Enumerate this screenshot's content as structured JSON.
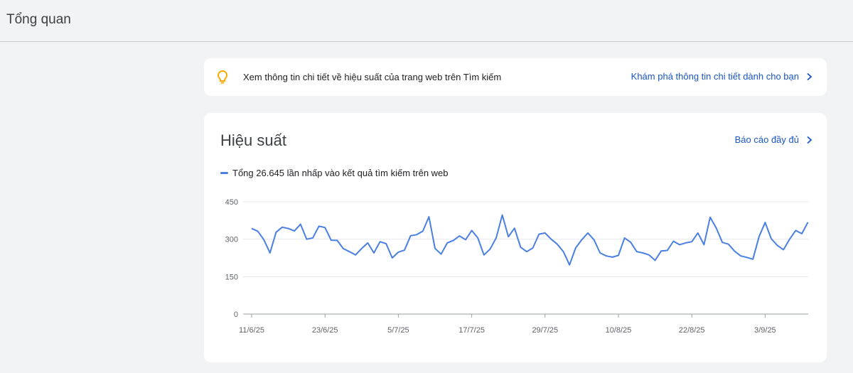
{
  "header": {
    "title": "Tổng quan"
  },
  "insight": {
    "text": "Xem thông tin chi tiết về hiệu suất của trang web trên Tìm kiếm",
    "link_label": "Khám phá thông tin chi tiết dành cho bạn",
    "icon": "lightbulb-icon",
    "icon_color": "#f9ab00"
  },
  "performance": {
    "title": "Hiệu suất",
    "full_report_label": "Báo cáo đầy đủ",
    "legend_label": "Tổng 26.645 lần nhấp vào kết quả tìm kiếm trên web"
  },
  "colors": {
    "accent": "#1a56c4",
    "series": "#4a7fe4",
    "background": "#f1f3f4"
  },
  "chart_data": {
    "type": "line",
    "x_ticks": [
      "11/6/25",
      "23/6/25",
      "5/7/25",
      "17/7/25",
      "29/7/25",
      "10/8/25",
      "22/8/25",
      "3/9/25"
    ],
    "y_ticks": [
      0,
      150,
      300,
      450
    ],
    "ylim": [
      0,
      450
    ],
    "grid": true,
    "series": [
      {
        "name": "Tổng 26.645 lần nhấp vào kết quả tìm kiếm trên web",
        "color": "#4a7fe4",
        "x": [
          "11/6/25",
          "12/6/25",
          "13/6/25",
          "14/6/25",
          "15/6/25",
          "16/6/25",
          "17/6/25",
          "18/6/25",
          "19/6/25",
          "20/6/25",
          "21/6/25",
          "22/6/25",
          "23/6/25",
          "24/6/25",
          "25/6/25",
          "26/6/25",
          "27/6/25",
          "28/6/25",
          "29/6/25",
          "30/6/25",
          "1/7/25",
          "2/7/25",
          "3/7/25",
          "4/7/25",
          "5/7/25",
          "6/7/25",
          "7/7/25",
          "8/7/25",
          "9/7/25",
          "10/7/25",
          "11/7/25",
          "12/7/25",
          "13/7/25",
          "14/7/25",
          "15/7/25",
          "16/7/25",
          "17/7/25",
          "18/7/25",
          "19/7/25",
          "20/7/25",
          "21/7/25",
          "22/7/25",
          "23/7/25",
          "24/7/25",
          "25/7/25",
          "26/7/25",
          "27/7/25",
          "28/7/25",
          "29/7/25",
          "30/7/25",
          "31/7/25",
          "1/8/25",
          "2/8/25",
          "3/8/25",
          "4/8/25",
          "5/8/25",
          "6/8/25",
          "7/8/25",
          "8/8/25",
          "9/8/25",
          "10/8/25",
          "11/8/25",
          "12/8/25",
          "13/8/25",
          "14/8/25",
          "15/8/25",
          "16/8/25",
          "17/8/25",
          "18/8/25",
          "19/8/25",
          "20/8/25",
          "21/8/25",
          "22/8/25",
          "23/8/25",
          "24/8/25",
          "25/8/25",
          "26/8/25",
          "27/8/25",
          "28/8/25",
          "29/8/25",
          "30/8/25",
          "31/8/25",
          "1/9/25",
          "2/9/25",
          "3/9/25",
          "4/9/25",
          "5/9/25",
          "6/9/25",
          "7/9/25",
          "8/9/25",
          "9/9/25",
          "10/9/25"
        ],
        "values": [
          343,
          332,
          298,
          245,
          328,
          348,
          343,
          333,
          360,
          300,
          305,
          352,
          347,
          296,
          295,
          262,
          250,
          237,
          263,
          285,
          245,
          290,
          282,
          225,
          248,
          256,
          314,
          318,
          332,
          390,
          263,
          240,
          285,
          295,
          313,
          298,
          335,
          305,
          237,
          260,
          305,
          397,
          310,
          344,
          268,
          250,
          265,
          320,
          325,
          300,
          280,
          250,
          197,
          265,
          298,
          325,
          298,
          245,
          233,
          228,
          235,
          305,
          288,
          250,
          245,
          237,
          215,
          253,
          255,
          292,
          278,
          285,
          290,
          325,
          278,
          388,
          345,
          287,
          280,
          252,
          233,
          227,
          220,
          310,
          367,
          302,
          275,
          258,
          300,
          335,
          322,
          368
        ]
      }
    ]
  }
}
